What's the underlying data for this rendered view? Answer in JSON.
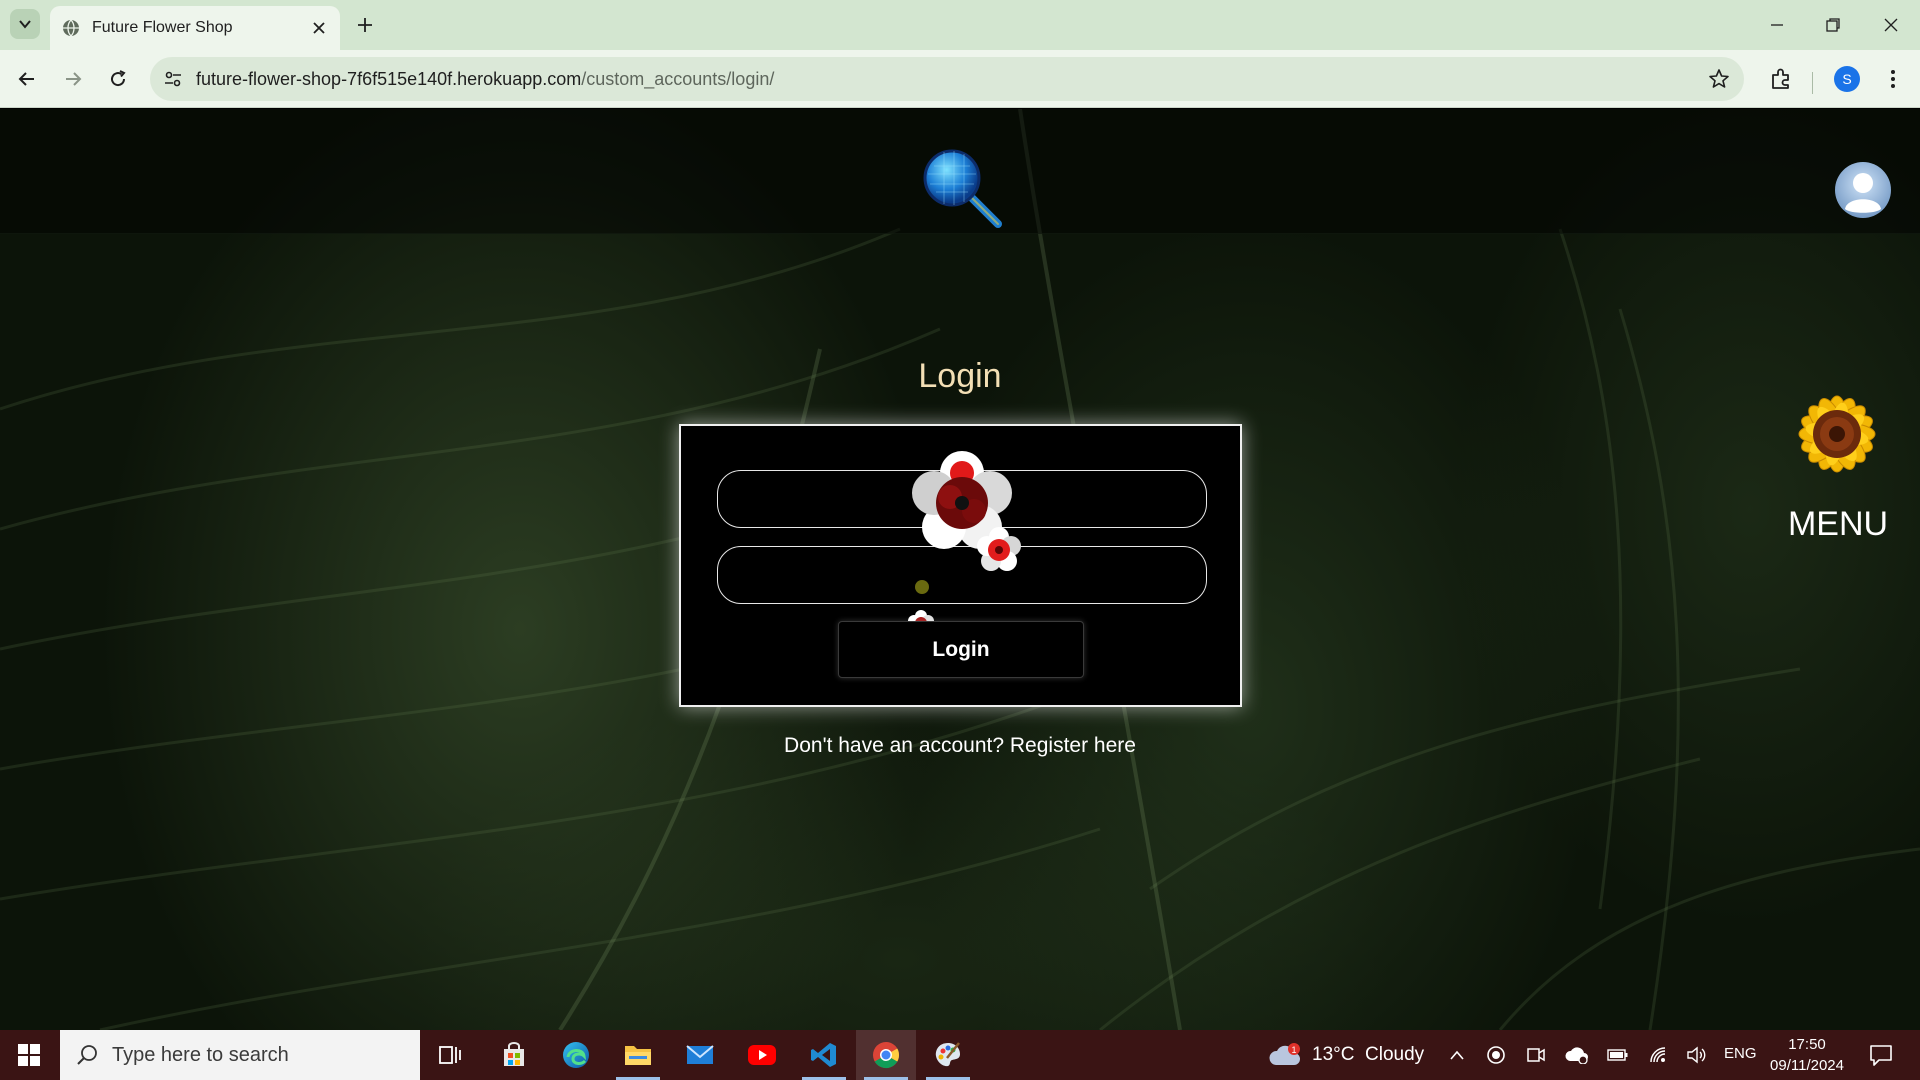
{
  "browser": {
    "tab_title": "Future Flower Shop",
    "url_host": "future-flower-shop-7f6f515e140f.herokuapp.com",
    "url_path": "/custom_accounts/login/",
    "profile_initial": "S"
  },
  "site": {
    "menu_label": "MENU"
  },
  "login": {
    "title": "Login",
    "button_label": "Login",
    "register_text": "Don't have an account? Register here",
    "username_value": "",
    "password_value": ""
  },
  "taskbar": {
    "search_placeholder": "Type here to search",
    "weather": "13°C  Cloudy",
    "weather_badge": "1",
    "language": "ENG",
    "time": "17:50",
    "date": "09/11/2024"
  },
  "colors": {
    "tab_bar": "#d3e6d0",
    "toolbar": "#eef5ec",
    "taskbar": "#3a1414",
    "login_title": "#f3dfb5",
    "page_bg": "#0c1409"
  }
}
